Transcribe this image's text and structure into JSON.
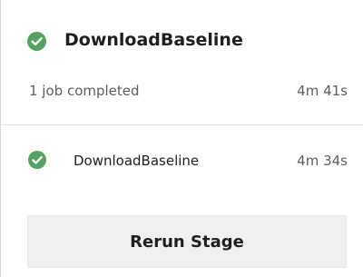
{
  "stage": {
    "title": "DownloadBaseline",
    "status_icon": "check-circle-icon",
    "summary": "1 job completed",
    "duration": "4m 41s"
  },
  "jobs": [
    {
      "name": "DownloadBaseline",
      "duration": "4m 34s",
      "status_icon": "check-circle-icon"
    }
  ],
  "actions": {
    "rerun_label": "Rerun Stage"
  },
  "colors": {
    "success": "#55a362",
    "button_bg": "#f0f0f0",
    "secondary_text": "#605e5c"
  }
}
